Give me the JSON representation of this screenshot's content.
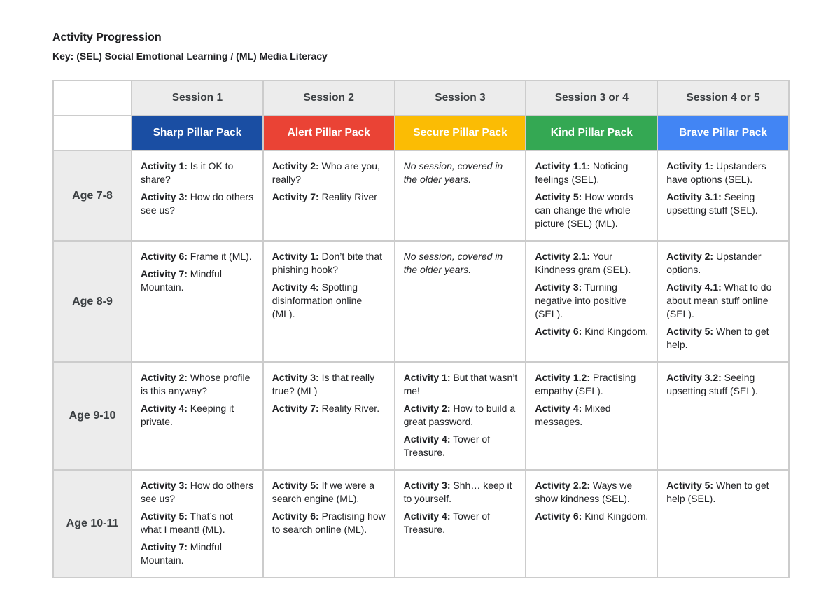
{
  "document": {
    "title": "Activity Progression",
    "key": "Key: (SEL) Social Emotional Learning / (ML) Media Literacy"
  },
  "sessions": [
    {
      "pre": "Session 1",
      "or": "",
      "post": ""
    },
    {
      "pre": "Session 2",
      "or": "",
      "post": ""
    },
    {
      "pre": "Session 3",
      "or": "",
      "post": ""
    },
    {
      "pre": "Session 3 ",
      "or": "or",
      "post": " 4"
    },
    {
      "pre": "Session 4 ",
      "or": "or",
      "post": " 5"
    }
  ],
  "packs": [
    {
      "label": "Sharp Pillar Pack",
      "color": "#1a4ea3"
    },
    {
      "label": "Alert Pillar Pack",
      "color": "#ea4335"
    },
    {
      "label": "Secure Pillar Pack",
      "color": "#fbbc04"
    },
    {
      "label": "Kind Pillar Pack",
      "color": "#34a853"
    },
    {
      "label": "Brave Pillar Pack",
      "color": "#4285f4"
    }
  ],
  "rows": [
    {
      "age": "Age 7-8",
      "cells": [
        {
          "items": [
            {
              "label": "Activity 1:",
              "text": " Is it OK to share?"
            },
            {
              "label": "Activity 3:",
              "text": " How do others see us?"
            }
          ]
        },
        {
          "items": [
            {
              "label": "Activity 2:",
              "text": " Who are you, really?"
            },
            {
              "label": "Activity 7:",
              "text": " Reality River"
            }
          ]
        },
        {
          "note": "No session, covered in the older years."
        },
        {
          "items": [
            {
              "label": "Activity 1.1:",
              "text": " Noticing feelings (SEL)."
            },
            {
              "label": "Activity 5:",
              "text": " How words can change the whole picture (SEL) (ML)."
            }
          ]
        },
        {
          "items": [
            {
              "label": "Activity 1:",
              "text": " Upstanders have options (SEL)."
            },
            {
              "label": "Activity 3.1:",
              "text": " Seeing upsetting stuff (SEL)."
            }
          ]
        }
      ]
    },
    {
      "age": "Age 8-9",
      "cells": [
        {
          "items": [
            {
              "label": "Activity 6:",
              "text": " Frame it (ML)."
            },
            {
              "label": "Activity 7:",
              "text": " Mindful Mountain."
            }
          ]
        },
        {
          "items": [
            {
              "label": "Activity 1:",
              "text": " Don’t bite that phishing hook?"
            },
            {
              "label": "Activity 4:",
              "text": " Spotting disinformation online (ML)."
            }
          ]
        },
        {
          "note": "No session, covered in the older years."
        },
        {
          "items": [
            {
              "label": "Activity 2.1:",
              "text": " Your Kindness gram (SEL)."
            },
            {
              "label": "Activity 3:",
              "text": " Turning negative into positive (SEL)."
            },
            {
              "label": "Activity 6:",
              "text": " Kind Kingdom."
            }
          ]
        },
        {
          "items": [
            {
              "label": "Activity 2:",
              "text": " Upstander options."
            },
            {
              "label": "Activity 4.1:",
              "text": " What to do about mean stuff online (SEL)."
            },
            {
              "label": "Activity 5:",
              "text": " When to get help."
            }
          ]
        }
      ]
    },
    {
      "age": "Age 9-10",
      "cells": [
        {
          "items": [
            {
              "label": "Activity 2:",
              "text": " Whose profile is this anyway?"
            },
            {
              "label": "Activity 4:",
              "text": " Keeping it private."
            }
          ]
        },
        {
          "items": [
            {
              "label": "Activity 3:",
              "text": " Is that really true? (ML)"
            },
            {
              "label": "Activity 7:",
              "text": " Reality River."
            }
          ]
        },
        {
          "items": [
            {
              "label": "Activity 1:",
              "text": " But that wasn’t me!"
            },
            {
              "label": "Activity 2:",
              "text": " How to build a great password."
            },
            {
              "label": "Activity 4:",
              "text": " Tower of Treasure."
            }
          ]
        },
        {
          "items": [
            {
              "label": "Activity 1.2:",
              "text": " Practising empathy (SEL)."
            },
            {
              "label": "Activity 4:",
              "text": " Mixed messages."
            }
          ]
        },
        {
          "items": [
            {
              "label": "Activity 3.2:",
              "text": " Seeing upsetting stuff (SEL)."
            }
          ]
        }
      ]
    },
    {
      "age": "Age 10-11",
      "cells": [
        {
          "items": [
            {
              "label": "Activity 3:",
              "text": " How do others see us?"
            },
            {
              "label": "Activity 5:",
              "text": " That’s not what I meant! (ML)."
            },
            {
              "label": "Activity 7:",
              "text": " Mindful Mountain."
            }
          ]
        },
        {
          "items": [
            {
              "label": "Activity 5:",
              "text": " If we were a search engine (ML)."
            },
            {
              "label": "Activity 6:",
              "text": " Practising how to search online (ML)."
            }
          ]
        },
        {
          "items": [
            {
              "label": "Activity 3:",
              "text": " Shh… keep it to yourself."
            },
            {
              "label": "Activity 4:",
              "text": " Tower of Treasure."
            }
          ]
        },
        {
          "items": [
            {
              "label": "Activity 2.2:",
              "text": " Ways we show kindness (SEL)."
            },
            {
              "label": "Activity 6:",
              "text": " Kind Kingdom."
            }
          ]
        },
        {
          "items": [
            {
              "label": "Activity 5:",
              "text": " When to get help (SEL)."
            }
          ]
        }
      ]
    }
  ]
}
